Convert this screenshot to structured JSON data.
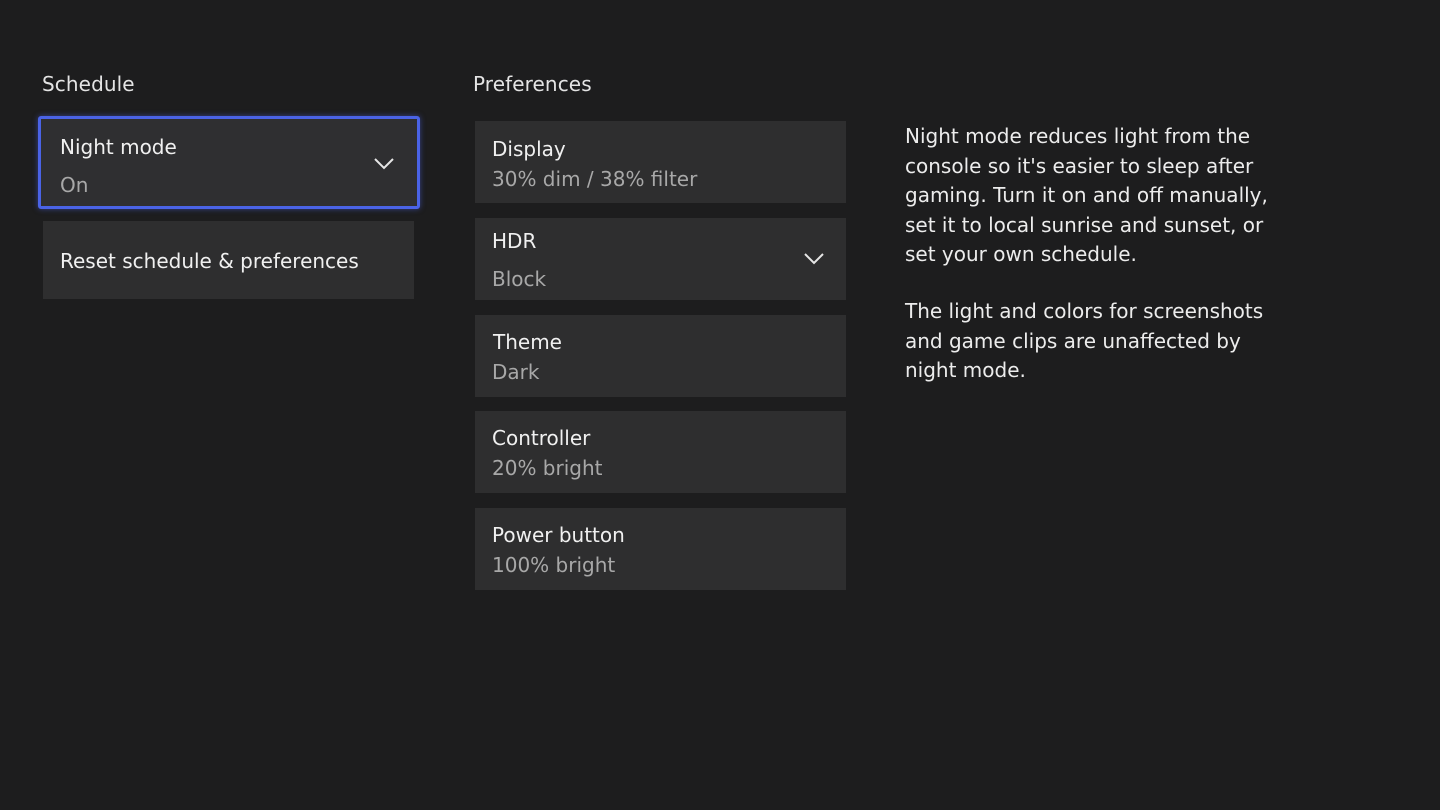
{
  "schedule": {
    "title": "Schedule",
    "night_mode": {
      "label": "Night mode",
      "value": "On",
      "icon": "chevron-down-icon"
    },
    "reset": {
      "label": "Reset schedule & preferences"
    }
  },
  "preferences": {
    "title": "Preferences",
    "display": {
      "label": "Display",
      "value": "30% dim / 38% filter"
    },
    "hdr": {
      "label": "HDR",
      "value": "Block",
      "icon": "chevron-down-icon"
    },
    "theme": {
      "label": "Theme",
      "value": "Dark"
    },
    "controller": {
      "label": "Controller",
      "value": "20% bright"
    },
    "power_button": {
      "label": "Power button",
      "value": "100% bright"
    }
  },
  "description": {
    "paragraph1": "Night mode reduces light from the console so it's easier to sleep after gaming. Turn it on and off manually, set it to local sunrise and sunset, or set your own schedule.",
    "paragraph2": "The light and colors for screenshots and game clips are unaffected by night mode."
  },
  "colors": {
    "background": "#1d1d1e",
    "tile": "#2e2e2f",
    "focus_accent": "#4a63e6"
  }
}
